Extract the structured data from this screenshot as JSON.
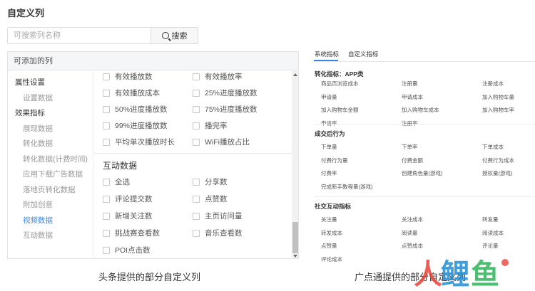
{
  "page_title": "自定义列",
  "search": {
    "placeholder": "可搜索列名称",
    "button_label": "搜索"
  },
  "left_panel": {
    "header": "可添加的列",
    "nav": [
      {
        "label": "属性设置",
        "level": "group"
      },
      {
        "label": "设置数据",
        "level": "sub"
      },
      {
        "label": "效果指标",
        "level": "group"
      },
      {
        "label": "展现数据",
        "level": "sub"
      },
      {
        "label": "转化数据",
        "level": "sub"
      },
      {
        "label": "转化数据(计费时间)",
        "level": "sub"
      },
      {
        "label": "应用下载广告数据",
        "level": "sub"
      },
      {
        "label": "落地页转化数据",
        "level": "sub"
      },
      {
        "label": "附加创意",
        "level": "sub"
      },
      {
        "label": "视频数据",
        "level": "sub",
        "active": true
      },
      {
        "label": "互动数据",
        "level": "sub"
      }
    ],
    "video_metrics": [
      "有效播放数",
      "有效播放率",
      "有效播放成本",
      "25%进度播放数",
      "50%进度播放数",
      "75%进度播放数",
      "99%进度播放数",
      "播完率",
      "平均单次播放时长",
      "WiFi播放占比"
    ],
    "interaction_section_title": "互动数据",
    "interaction_metrics": [
      "全选",
      "分享数",
      "评论提交数",
      "点赞数",
      "新增关注数",
      "主页访问量",
      "挑战赛查看数",
      "音乐查看数",
      "POI点击数"
    ]
  },
  "right_panel": {
    "tabs": [
      "系统指标",
      "自定义指标"
    ],
    "sections": [
      {
        "title": "转化指标：APP类",
        "items": [
          "商品页浏览成本",
          "注册量",
          "注册成本",
          "申请量",
          "申请成本",
          "加入购物车量",
          "加入购物车金额",
          "加入购物车成本",
          "加入购物车率",
          "申请率",
          "注册率"
        ]
      },
      {
        "title": "成交后行为",
        "items": [
          "下单量",
          "下单率",
          "下单成本",
          "付费行为量",
          "付费金额",
          "付费行为成本",
          "付费率",
          "创建角色量(游戏)",
          "授权量(游戏)",
          "完成新手教程量(游戏)"
        ]
      },
      {
        "title": "社交互动指标",
        "items": [
          "关注量",
          "关注成本",
          "转发量",
          "转发成本",
          "阅读量",
          "阅读成本",
          "点赞量",
          "点赞成本",
          "评论量",
          "评论成本"
        ]
      }
    ]
  },
  "captions": {
    "left": "头条提供的部分自定义列",
    "right": "广点通提供的部分自定义列"
  },
  "watermark_text": "人人都是鲤鱼",
  "colors": {
    "accent": "#3a86e8",
    "watermark_red": "#e8443a",
    "watermark_blue": "#1e8fd6",
    "watermark_green": "#2fb55a"
  }
}
